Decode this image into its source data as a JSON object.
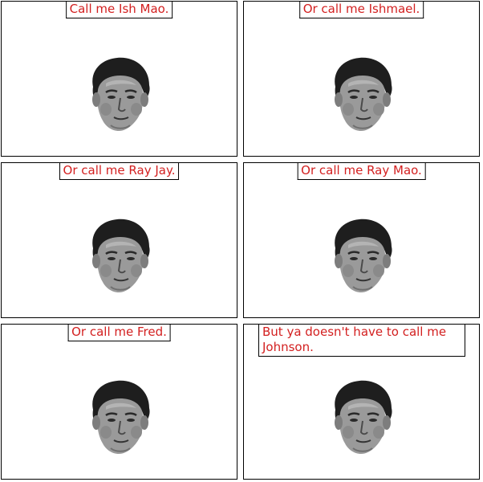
{
  "comic": {
    "panels": [
      {
        "caption": "Call me Ish Mao."
      },
      {
        "caption": "Or call me Ishmael."
      },
      {
        "caption": "Or call me Ray Jay."
      },
      {
        "caption": "Or call me Ray Mao."
      },
      {
        "caption": "Or call me Fred."
      },
      {
        "caption": "But ya doesn't have to call me Johnson."
      }
    ],
    "colors": {
      "caption_text": "#d32020",
      "border": "#000000",
      "background": "#ffffff"
    },
    "icon": "face-portrait-icon"
  }
}
